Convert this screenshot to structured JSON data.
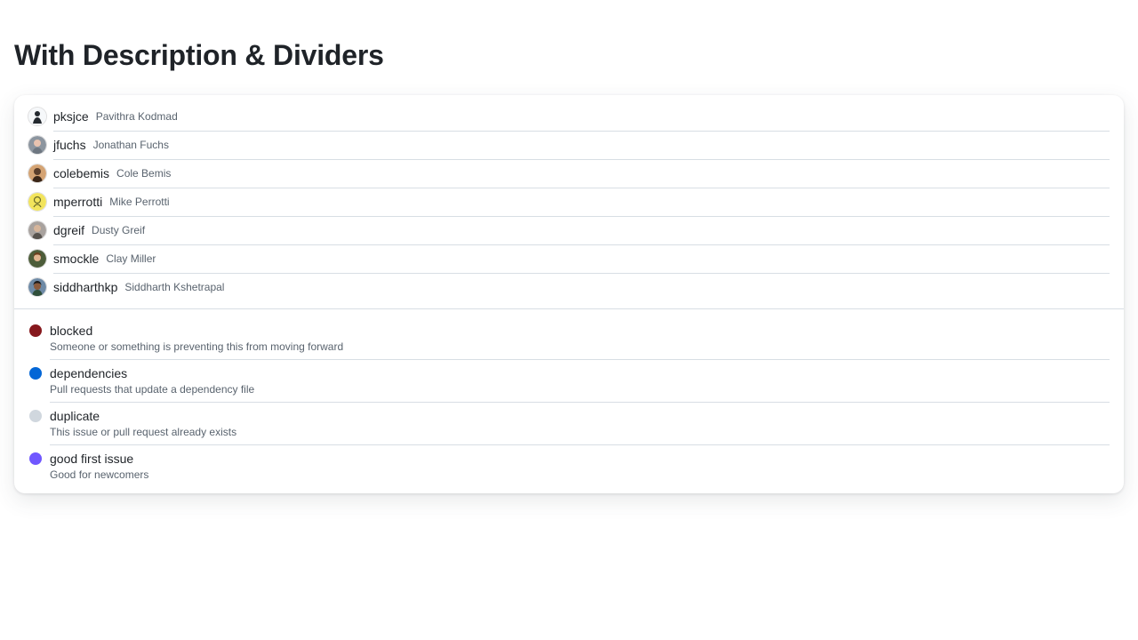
{
  "page": {
    "title": "With Description & Dividers"
  },
  "users": [
    {
      "login": "pksjce",
      "name": "Pavithra Kodmad",
      "avatar_icon": "avatar-pksjce"
    },
    {
      "login": "jfuchs",
      "name": "Jonathan Fuchs",
      "avatar_icon": "avatar-jfuchs"
    },
    {
      "login": "colebemis",
      "name": "Cole Bemis",
      "avatar_icon": "avatar-colebemis"
    },
    {
      "login": "mperrotti",
      "name": "Mike Perrotti",
      "avatar_icon": "avatar-mperrotti"
    },
    {
      "login": "dgreif",
      "name": "Dusty Greif",
      "avatar_icon": "avatar-dgreif"
    },
    {
      "login": "smockle",
      "name": "Clay Miller",
      "avatar_icon": "avatar-smockle"
    },
    {
      "login": "siddharthkp",
      "name": "Siddharth Kshetrapal",
      "avatar_icon": "avatar-siddharthkp"
    }
  ],
  "labels": [
    {
      "name": "blocked",
      "description": "Someone or something is preventing this from moving forward",
      "color": "#86181d"
    },
    {
      "name": "dependencies",
      "description": "Pull requests that update a dependency file",
      "color": "#0366d6"
    },
    {
      "name": "duplicate",
      "description": "This issue or pull request already exists",
      "color": "#d0d7de"
    },
    {
      "name": "good first issue",
      "description": "Good for newcomers",
      "color": "#7057ff"
    }
  ],
  "colors": {
    "text_primary": "#1f2328",
    "text_muted": "#59636e",
    "divider": "#d8dee4"
  }
}
